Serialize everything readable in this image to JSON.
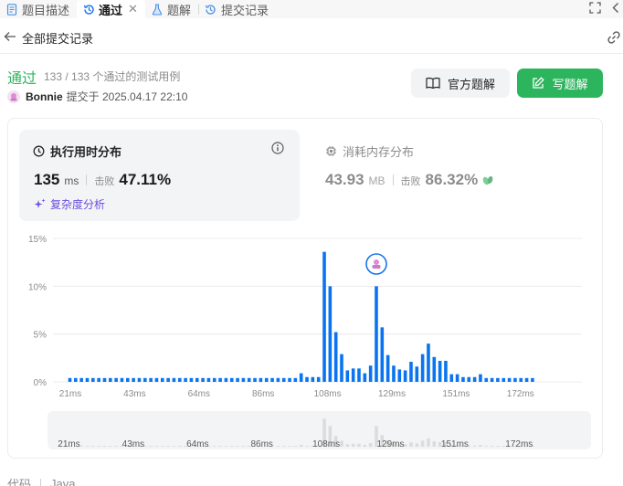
{
  "tabs": [
    {
      "label": "题目描述",
      "icon": "document-icon",
      "active": false
    },
    {
      "label": "通过",
      "icon": "history-icon",
      "active": true
    },
    {
      "label": "题解",
      "icon": "flask-icon",
      "active": false
    },
    {
      "label": "提交记录",
      "icon": "history-icon",
      "active": false
    }
  ],
  "back": {
    "label": "全部提交记录"
  },
  "result": {
    "status": "通过",
    "passed": "133 / 133 个通过的测试用例",
    "user": "Bonnie",
    "submitted_text": "提交于 2025.04.17 22:10"
  },
  "buttons": {
    "official": "官方题解",
    "write": "写题解"
  },
  "runtime": {
    "title": "执行用时分布",
    "value": "135",
    "unit": "ms",
    "beat_label": "击败",
    "beat_value": "47.11%",
    "complexity": "复杂度分析"
  },
  "memory": {
    "title": "消耗内存分布",
    "value": "43.93",
    "unit": "MB",
    "beat_label": "击败",
    "beat_value": "86.32%"
  },
  "colors": {
    "accent_green": "#2db55d",
    "bar_blue": "#0a74f0",
    "purple": "#6b4be0"
  },
  "chart_data": {
    "type": "bar",
    "y_ticks": [
      "15%",
      "10%",
      "5%",
      "0%"
    ],
    "x_ticks": [
      "21ms",
      "43ms",
      "64ms",
      "86ms",
      "108ms",
      "129ms",
      "151ms",
      "172ms"
    ],
    "ylim": [
      0,
      15
    ],
    "values": [
      0.4,
      0.4,
      0.4,
      0.4,
      0.4,
      0.4,
      0.4,
      0.4,
      0.4,
      0.4,
      0.4,
      0.4,
      0.4,
      0.4,
      0.4,
      0.4,
      0.4,
      0.4,
      0.4,
      0.4,
      0.4,
      0.4,
      0.4,
      0.4,
      0.4,
      0.4,
      0.4,
      0.4,
      0.4,
      0.4,
      0.4,
      0.4,
      0.4,
      0.4,
      0.4,
      0.4,
      0.4,
      0.4,
      0.4,
      0.4,
      0.9,
      0.5,
      0.5,
      0.5,
      13.6,
      10.0,
      5.2,
      2.9,
      1.2,
      1.4,
      1.4,
      0.9,
      1.7,
      10.0,
      5.7,
      2.8,
      1.7,
      1.3,
      1.2,
      2.1,
      1.6,
      2.9,
      4.0,
      2.6,
      2.2,
      2.2,
      0.8,
      0.8,
      0.5,
      0.5,
      0.5,
      0.8,
      0.4,
      0.4,
      0.4,
      0.4,
      0.4,
      0.4,
      0.4,
      0.4,
      0.4
    ],
    "highlight_index": 53,
    "grid": true
  },
  "footer": {
    "code_label": "代码",
    "lang": "Java"
  }
}
